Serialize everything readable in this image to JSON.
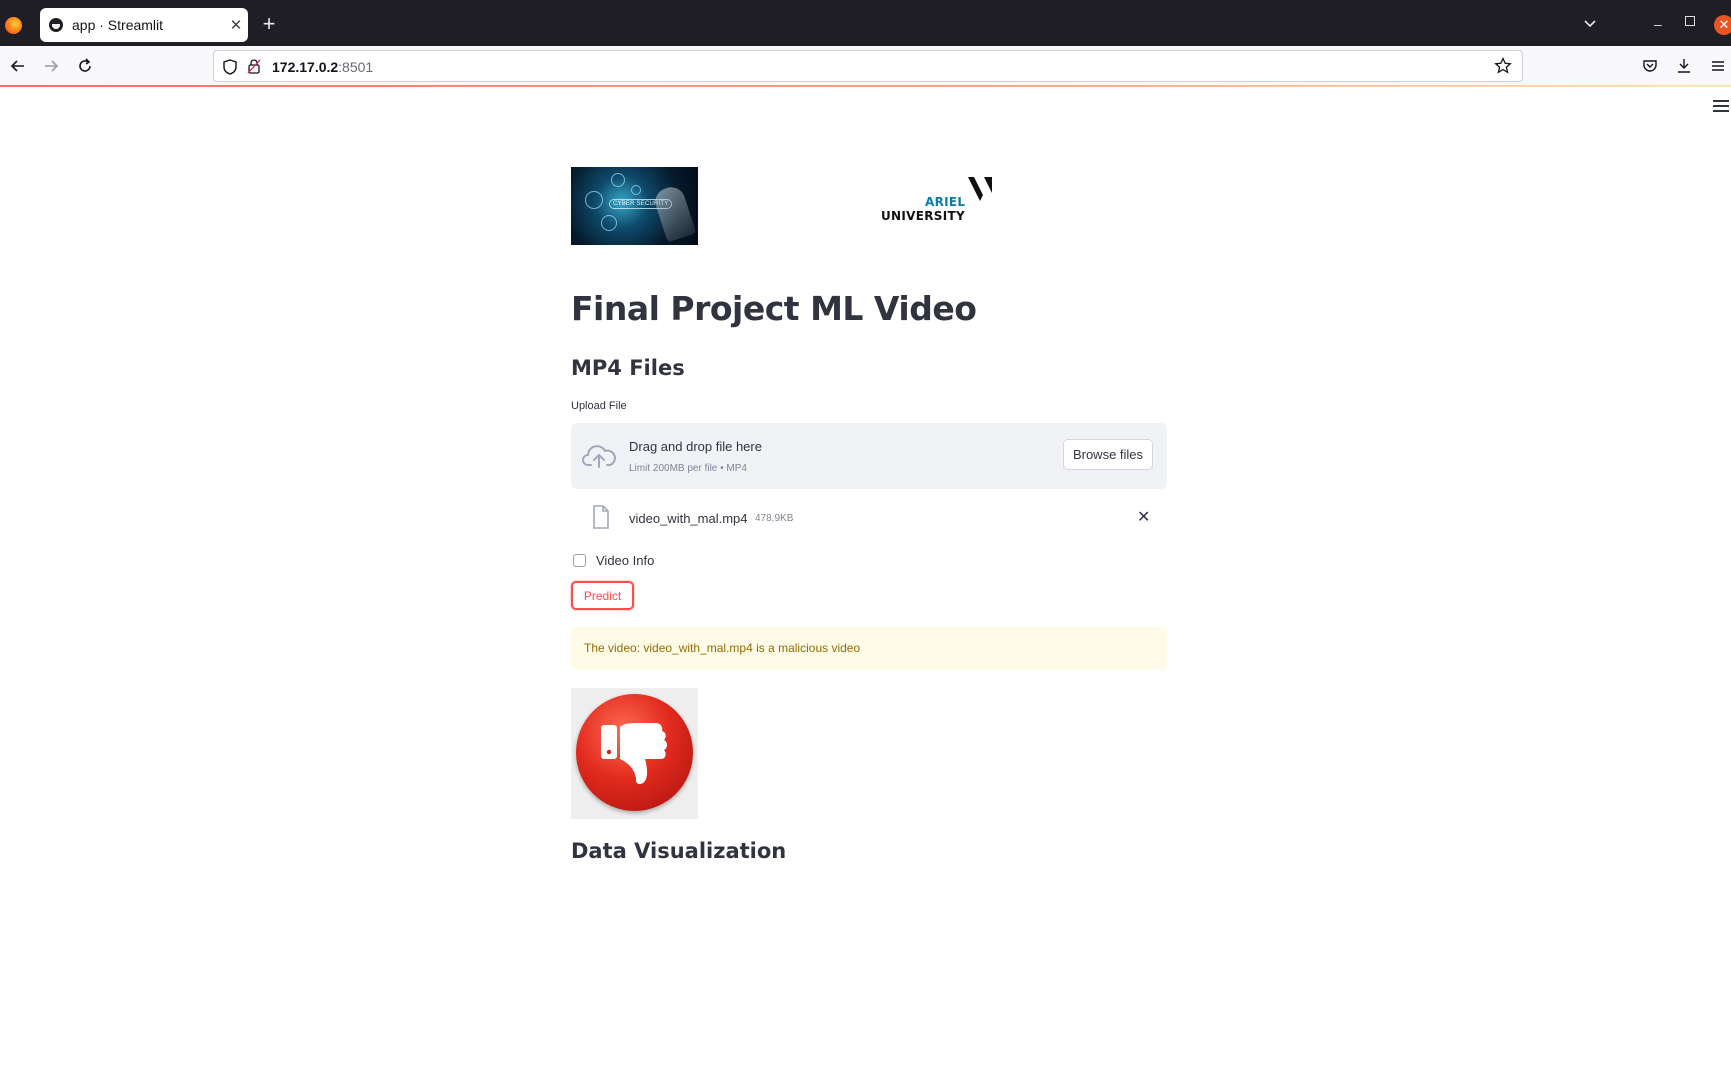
{
  "browser": {
    "tab_title": "app · Streamlit",
    "url_host": "172.17.0.2",
    "url_port": ":8501"
  },
  "page": {
    "title": "Final Project ML Video",
    "section_heading": "MP4 Files",
    "upload_label": "Upload File",
    "dropzone_main": "Drag and drop file here",
    "dropzone_sub": "Limit 200MB per file • MP4",
    "browse_label": "Browse files",
    "uploaded_file": {
      "name": "video_with_mal.mp4",
      "size": "478.9KB"
    },
    "checkbox_label": "Video Info",
    "checkbox_checked": false,
    "predict_label": "Predict",
    "result_message": "The video: video_with_mal.mp4 is a malicious video",
    "data_viz_heading": "Data Visualization"
  },
  "logos": {
    "left_image_text": "CYBER SECURITY",
    "university_line1": "ARIEL",
    "university_line2": "UNIVERSITY"
  },
  "colors": {
    "primary": "#ff4b4b",
    "text": "#31333f",
    "warning_bg": "#fffbe6",
    "warning_text": "#926c05",
    "dropzone_bg": "#f0f2f6"
  }
}
